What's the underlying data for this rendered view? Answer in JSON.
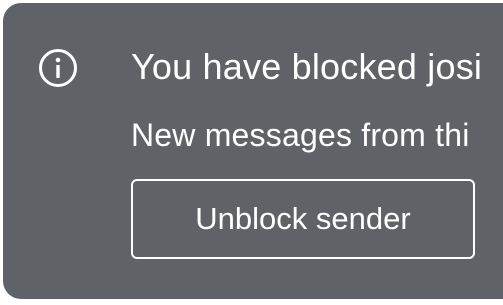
{
  "banner": {
    "icon": "info-icon",
    "title": "You have blocked josi",
    "subtitle": "New messages from thi",
    "unblock_label": "Unblock sender",
    "colors": {
      "background": "#5f6368",
      "text": "#ffffff"
    }
  }
}
